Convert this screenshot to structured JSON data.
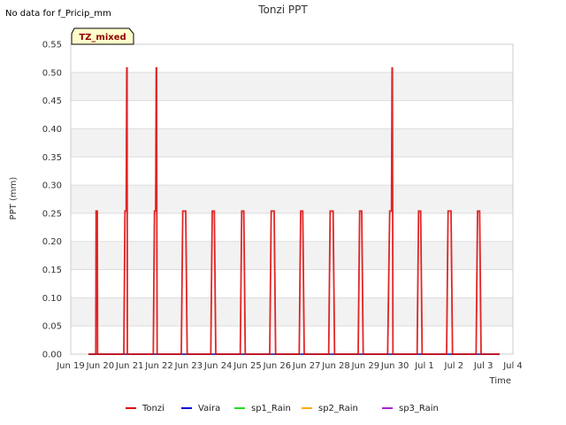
{
  "chart_data": {
    "type": "line",
    "title": "Tonzi PPT",
    "note": "No data for f_Pricip_mm",
    "badge": "TZ_mixed",
    "xlabel": "Time",
    "ylabel": "PPT (mm)",
    "ylim": [
      0,
      0.55
    ],
    "xlim": [
      0,
      15
    ],
    "y_ticks": [
      "0.00",
      "0.05",
      "0.10",
      "0.15",
      "0.20",
      "0.25",
      "0.30",
      "0.35",
      "0.40",
      "0.45",
      "0.50",
      "0.55"
    ],
    "x_ticks": [
      {
        "value": 0,
        "label": "Jun 19"
      },
      {
        "value": 1,
        "label": "Jun 20"
      },
      {
        "value": 2,
        "label": "Jun 21"
      },
      {
        "value": 3,
        "label": "Jun 22"
      },
      {
        "value": 4,
        "label": "Jun 23"
      },
      {
        "value": 5,
        "label": "Jun 24"
      },
      {
        "value": 6,
        "label": "Jun 25"
      },
      {
        "value": 7,
        "label": "Jun 26"
      },
      {
        "value": 8,
        "label": "Jun 27"
      },
      {
        "value": 9,
        "label": "Jun 28"
      },
      {
        "value": 10,
        "label": "Jun 29"
      },
      {
        "value": 11,
        "label": "Jun 30"
      },
      {
        "value": 12,
        "label": "Jul 1"
      },
      {
        "value": 13,
        "label": "Jul 2"
      },
      {
        "value": 14,
        "label": "Jul 3"
      },
      {
        "value": 15,
        "label": "Jul 4"
      }
    ],
    "grid": true,
    "legend_position": "bottom",
    "series": [
      {
        "name": "Tonzi",
        "color": "#dd0000",
        "points": [
          [
            0.6,
            0
          ],
          [
            0.85,
            0
          ],
          [
            0.86,
            0.254
          ],
          [
            0.9,
            0.254
          ],
          [
            0.91,
            0
          ],
          [
            1.8,
            0
          ],
          [
            1.84,
            0.254
          ],
          [
            1.88,
            0.254
          ],
          [
            1.9,
            0.508
          ],
          [
            1.91,
            0.508
          ],
          [
            1.92,
            0
          ],
          [
            2.8,
            0
          ],
          [
            2.84,
            0.254
          ],
          [
            2.88,
            0.254
          ],
          [
            2.9,
            0.508
          ],
          [
            2.91,
            0.508
          ],
          [
            2.93,
            0
          ],
          [
            3.75,
            0
          ],
          [
            3.8,
            0.254
          ],
          [
            3.9,
            0.254
          ],
          [
            3.95,
            0
          ],
          [
            4.75,
            0
          ],
          [
            4.8,
            0.254
          ],
          [
            4.87,
            0.254
          ],
          [
            4.92,
            0
          ],
          [
            5.75,
            0
          ],
          [
            5.8,
            0.254
          ],
          [
            5.87,
            0.254
          ],
          [
            5.92,
            0
          ],
          [
            6.75,
            0
          ],
          [
            6.8,
            0.254
          ],
          [
            6.9,
            0.254
          ],
          [
            6.95,
            0
          ],
          [
            7.75,
            0
          ],
          [
            7.8,
            0.254
          ],
          [
            7.87,
            0.254
          ],
          [
            7.92,
            0
          ],
          [
            8.75,
            0
          ],
          [
            8.8,
            0.254
          ],
          [
            8.9,
            0.254
          ],
          [
            8.95,
            0
          ],
          [
            9.75,
            0
          ],
          [
            9.8,
            0.254
          ],
          [
            9.87,
            0.254
          ],
          [
            9.92,
            0
          ],
          [
            10.75,
            0
          ],
          [
            10.82,
            0.254
          ],
          [
            10.88,
            0.254
          ],
          [
            10.9,
            0.508
          ],
          [
            10.91,
            0.508
          ],
          [
            10.93,
            0
          ],
          [
            11.75,
            0
          ],
          [
            11.8,
            0.254
          ],
          [
            11.87,
            0.254
          ],
          [
            11.92,
            0
          ],
          [
            12.75,
            0
          ],
          [
            12.8,
            0.254
          ],
          [
            12.9,
            0.254
          ],
          [
            12.95,
            0
          ],
          [
            13.75,
            0
          ],
          [
            13.8,
            0.254
          ],
          [
            13.87,
            0.254
          ],
          [
            13.92,
            0
          ],
          [
            14.55,
            0
          ]
        ]
      },
      {
        "name": "Vaira",
        "color": "#0000cc",
        "points": [
          [
            0.6,
            0
          ],
          [
            14.55,
            0
          ]
        ]
      },
      {
        "name": "sp1_Rain",
        "color": "#22dd22",
        "points": [
          [
            0.6,
            0
          ],
          [
            14.55,
            0
          ]
        ]
      },
      {
        "name": "sp2_Rain",
        "color": "#ffaa00",
        "points": [
          [
            0.6,
            0
          ],
          [
            14.55,
            0
          ]
        ]
      },
      {
        "name": "sp3_Rain",
        "color": "#aa22cc",
        "points": [
          [
            0.6,
            0
          ],
          [
            14.55,
            0
          ]
        ]
      }
    ]
  }
}
